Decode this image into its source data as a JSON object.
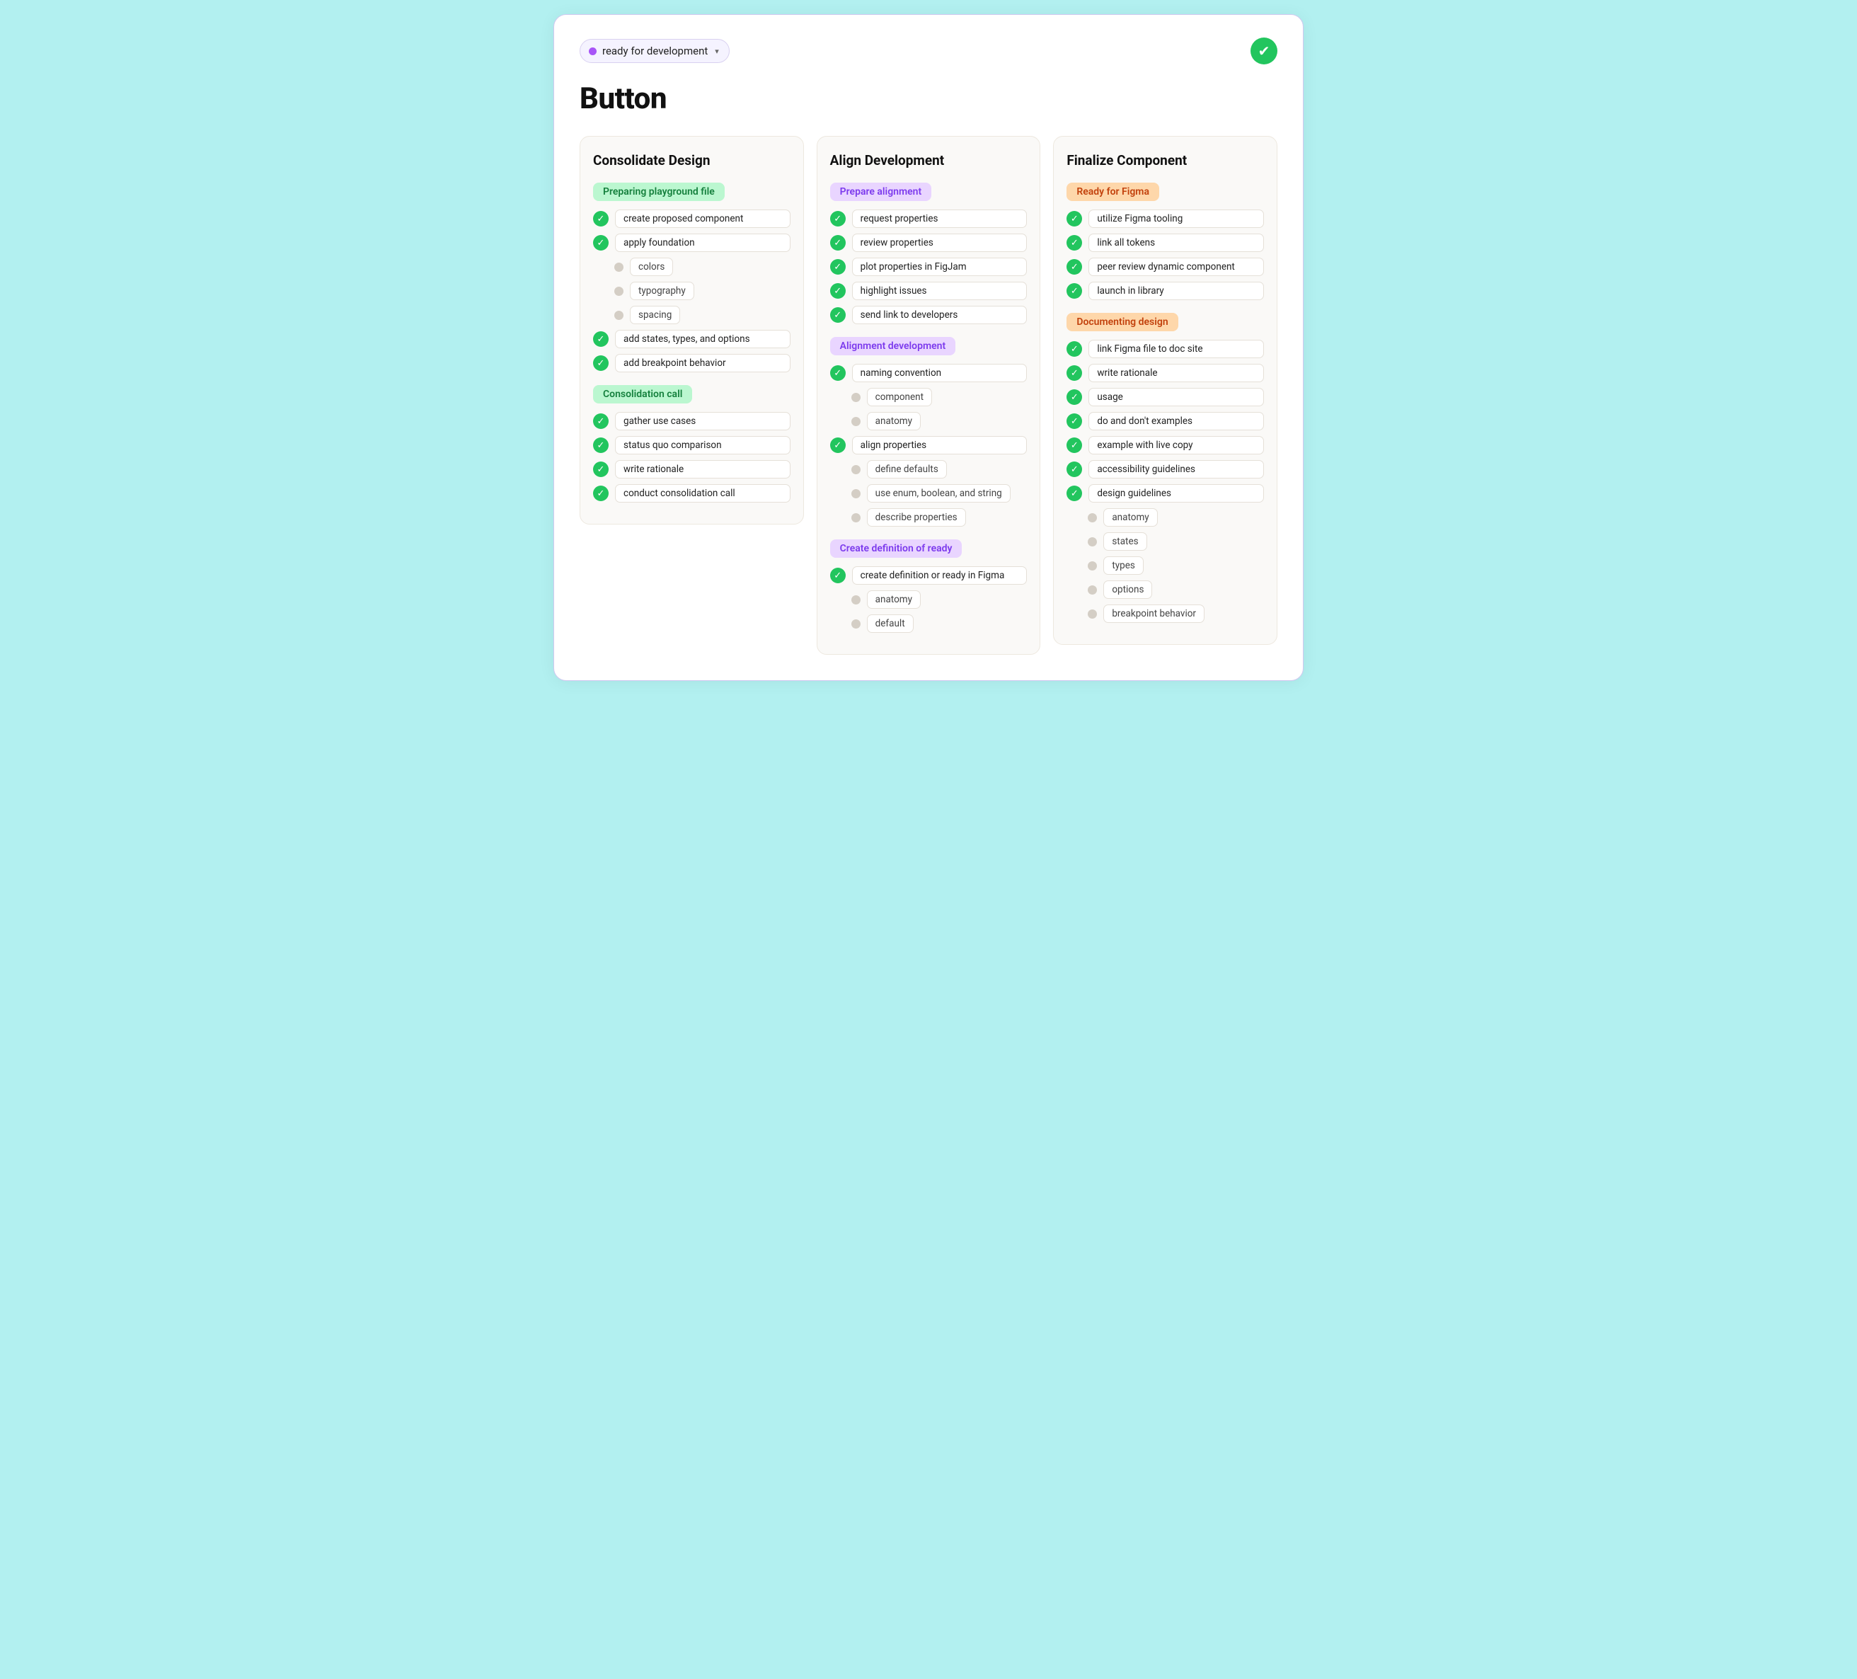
{
  "header": {
    "status_label": "ready for development",
    "badge_icon": "✔",
    "title": "Button",
    "status_dot_color": "#a855f7"
  },
  "columns": [
    {
      "id": "consolidate",
      "title": "Consolidate Design",
      "sections": [
        {
          "label": "Preparing playground file",
          "label_style": "green",
          "items": [
            {
              "type": "check",
              "text": "create proposed component"
            },
            {
              "type": "check",
              "text": "apply foundation"
            },
            {
              "type": "sub",
              "text": "colors"
            },
            {
              "type": "sub",
              "text": "typography"
            },
            {
              "type": "sub",
              "text": "spacing"
            },
            {
              "type": "check",
              "text": "add states, types, and options"
            },
            {
              "type": "check",
              "text": "add breakpoint behavior"
            }
          ]
        },
        {
          "label": "Consolidation call",
          "label_style": "green",
          "items": [
            {
              "type": "check",
              "text": "gather use cases"
            },
            {
              "type": "check",
              "text": "status quo comparison"
            },
            {
              "type": "check",
              "text": "write rationale"
            },
            {
              "type": "check",
              "text": "conduct consolidation call"
            }
          ]
        }
      ]
    },
    {
      "id": "align",
      "title": "Align Development",
      "sections": [
        {
          "label": "Prepare alignment",
          "label_style": "purple",
          "items": [
            {
              "type": "check",
              "text": "request properties"
            },
            {
              "type": "check",
              "text": "review properties"
            },
            {
              "type": "check",
              "text": "plot properties in FigJam"
            },
            {
              "type": "check",
              "text": "highlight issues"
            },
            {
              "type": "check",
              "text": "send link to developers"
            }
          ]
        },
        {
          "label": "Alignment development",
          "label_style": "purple",
          "items": [
            {
              "type": "check",
              "text": "naming convention"
            },
            {
              "type": "sub",
              "text": "component"
            },
            {
              "type": "sub",
              "text": "anatomy"
            },
            {
              "type": "check",
              "text": "align properties"
            },
            {
              "type": "sub",
              "text": "define defaults"
            },
            {
              "type": "sub",
              "text": "use enum, boolean, and string"
            },
            {
              "type": "sub",
              "text": "describe properties"
            }
          ]
        },
        {
          "label": "Create definition of ready",
          "label_style": "purple",
          "items": [
            {
              "type": "check",
              "text": "create definition or ready in Figma"
            },
            {
              "type": "sub",
              "text": "anatomy"
            },
            {
              "type": "sub",
              "text": "default"
            }
          ]
        }
      ]
    },
    {
      "id": "finalize",
      "title": "Finalize Component",
      "sections": [
        {
          "label": "Ready for Figma",
          "label_style": "orange",
          "items": [
            {
              "type": "check",
              "text": "utilize Figma tooling"
            },
            {
              "type": "check",
              "text": "link all tokens"
            },
            {
              "type": "check",
              "text": "peer review dynamic component"
            },
            {
              "type": "check",
              "text": "launch in library"
            }
          ]
        },
        {
          "label": "Documenting design",
          "label_style": "orange",
          "items": [
            {
              "type": "check",
              "text": "link Figma file to doc site"
            },
            {
              "type": "check",
              "text": "write rationale"
            },
            {
              "type": "check",
              "text": "usage"
            },
            {
              "type": "check",
              "text": "do and don't examples"
            },
            {
              "type": "check",
              "text": "example with live copy"
            },
            {
              "type": "check",
              "text": "accessibility guidelines"
            },
            {
              "type": "check",
              "text": "design guidelines"
            },
            {
              "type": "sub",
              "text": "anatomy"
            },
            {
              "type": "sub",
              "text": "states"
            },
            {
              "type": "sub",
              "text": "types"
            },
            {
              "type": "sub",
              "text": "options"
            },
            {
              "type": "sub",
              "text": "breakpoint behavior"
            }
          ]
        }
      ]
    }
  ]
}
